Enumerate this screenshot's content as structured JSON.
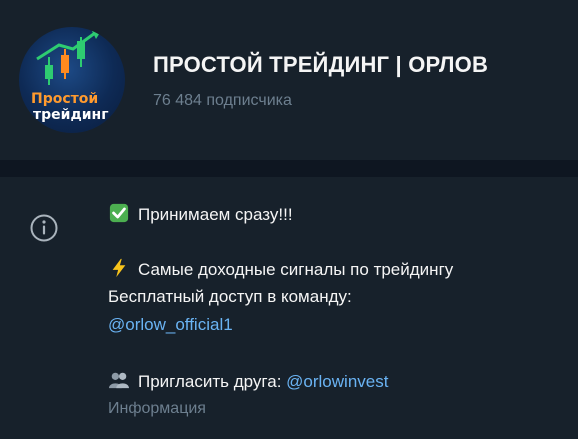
{
  "channel": {
    "title": "ПРОСТОЙ ТРЕЙДИНГ | ОРЛОВ",
    "subscribers": "76 484 подписчика",
    "avatar": {
      "line1": "Простой",
      "line2": "трейдинг"
    }
  },
  "description": {
    "line1": "Принимаем сразу!!!",
    "line2": "Самые доходные сигналы по трейдингу",
    "line3": "Бесплатный доступ в команду:",
    "link1": "@orlow_official1",
    "line4_prefix": "Пригласить друга: ",
    "link2": "@orlowinvest",
    "caption": "Информация"
  },
  "icons": {
    "info": "info-circle-icon",
    "check": "check-mark-button-icon",
    "bolt": "high-voltage-icon",
    "people": "busts-in-silhouette-icon"
  },
  "colors": {
    "background": "#17212b",
    "divider": "#0e1621",
    "text": "#f5f5f5",
    "muted": "#6d7f8f",
    "link": "#6ab3f3"
  }
}
